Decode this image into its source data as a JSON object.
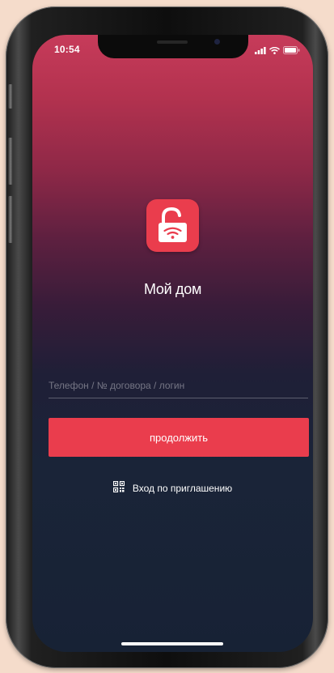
{
  "status_bar": {
    "time": "10:54",
    "icons": [
      "signal-icon",
      "wifi-icon",
      "battery-icon"
    ]
  },
  "app": {
    "icon": "open-lock-wifi-icon",
    "name": "Мой дом"
  },
  "login": {
    "placeholder": "Телефон / № договора / логин",
    "value": ""
  },
  "continue_button": {
    "label": "продолжить"
  },
  "invite": {
    "icon": "qr-code-icon",
    "label": "Вход по приглашению"
  },
  "colors": {
    "accent": "#ea3d4d",
    "background_top": "#c73b5a",
    "background_bottom": "#172235",
    "text": "#ffffff"
  }
}
